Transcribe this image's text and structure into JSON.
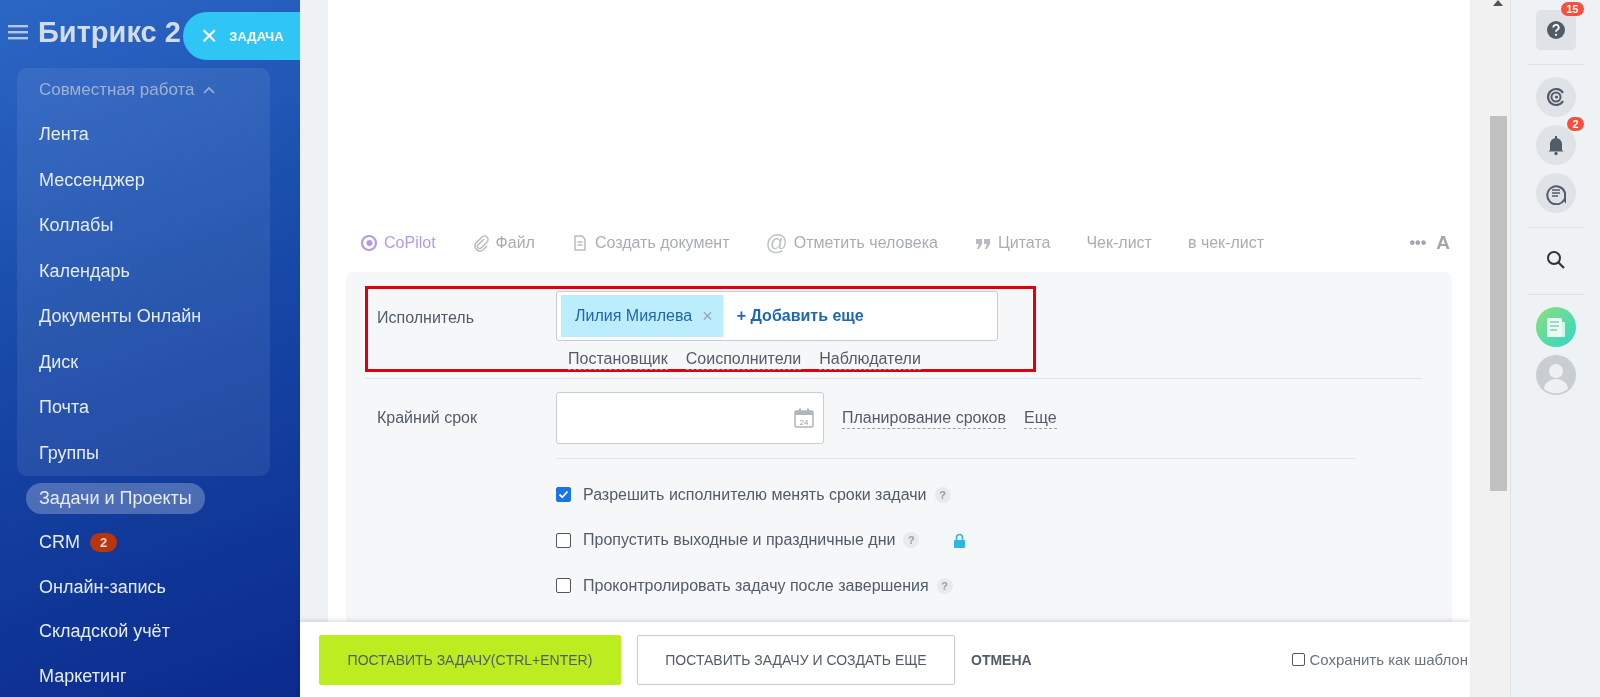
{
  "sidebar": {
    "logo": "Битрикс 2",
    "close_button": {
      "icon": "×",
      "label": "ЗАДАЧА"
    },
    "groups": [
      {
        "label": "Совместная работа",
        "expanded": true,
        "children": [
          {
            "label": "Лента"
          },
          {
            "label": "Мессенджер"
          },
          {
            "label": "Коллабы"
          },
          {
            "label": "Календарь"
          },
          {
            "label": "Документы Онлайн"
          },
          {
            "label": "Диск"
          },
          {
            "label": "Почта"
          },
          {
            "label": "Группы"
          }
        ]
      }
    ],
    "items": [
      {
        "label": "Задачи и Проекты",
        "selected": true
      },
      {
        "label": "CRM",
        "selected": false,
        "badge": "2"
      },
      {
        "label": "Онлайн-запись",
        "selected": false
      },
      {
        "label": "Складской учёт",
        "selected": false
      },
      {
        "label": "Маркетинг",
        "selected": false
      }
    ]
  },
  "toolbar": {
    "items": [
      {
        "kind": "copilot",
        "label": "CoPilot"
      },
      {
        "kind": "file",
        "label": "Файл"
      },
      {
        "kind": "document",
        "label": "Создать документ"
      },
      {
        "kind": "mention",
        "icon": "@",
        "label": "Отметить человека"
      },
      {
        "kind": "quote",
        "label": "Цитата"
      },
      {
        "kind": "plain",
        "label": "Чек-лист"
      },
      {
        "kind": "plain",
        "label": "в чек-лист"
      }
    ],
    "more": "•••",
    "format": "A"
  },
  "form": {
    "assignee": {
      "label": "Исполнитель",
      "highlighted": true,
      "tags": [
        {
          "label": "Лилия Миялева",
          "remove": "×"
        }
      ],
      "add_link": "+ Добавить еще",
      "role_links": [
        "Постановщик",
        "Соисполнители",
        "Наблюдатели"
      ]
    },
    "deadline": {
      "label": "Крайний срок",
      "calendar_day": "24",
      "links": [
        "Планирование сроков",
        "Еще"
      ]
    },
    "options": [
      {
        "label": "Разрешить исполнителю менять сроки задачи",
        "checked": true,
        "help": "?",
        "locked": false
      },
      {
        "label": "Пропустить выходные и праздничные дни",
        "checked": false,
        "help": "?",
        "locked": true
      },
      {
        "label": "Проконтролировать задачу после завершения",
        "checked": false,
        "help": "?",
        "locked": false
      }
    ]
  },
  "footer": {
    "buttons": [
      {
        "kind": "primary",
        "label": "ПОСТАВИТЬ ЗАДАЧУ(CTRL+ENTER)"
      },
      {
        "kind": "secondary",
        "label": "ПОСТАВИТЬ ЗАДАЧУ И СОЗДАТЬ ЕЩЕ"
      },
      {
        "kind": "link",
        "label": "ОТМЕНА"
      }
    ],
    "template": {
      "label": "Сохранить как шаблон",
      "checked": false
    }
  },
  "right_bar": {
    "items": [
      {
        "kind": "help",
        "badge": "15"
      },
      {
        "kind": "divider"
      },
      {
        "kind": "copilot"
      },
      {
        "kind": "bell",
        "badge": "2"
      },
      {
        "kind": "chat"
      },
      {
        "kind": "divider"
      },
      {
        "kind": "search"
      },
      {
        "kind": "divider"
      },
      {
        "kind": "news"
      },
      {
        "kind": "avatar"
      }
    ]
  }
}
